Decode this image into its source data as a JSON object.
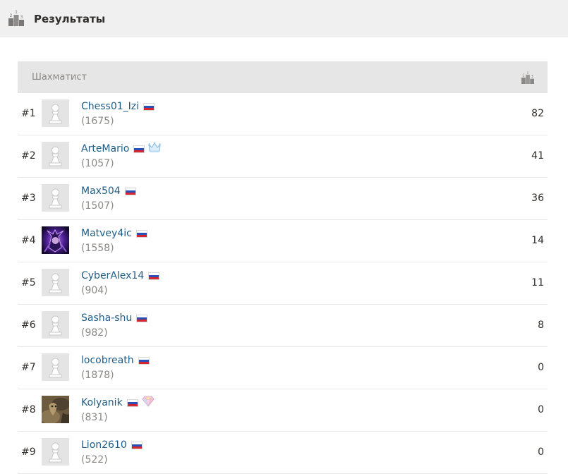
{
  "header": {
    "title": "Результаты",
    "icon": "podium-icon"
  },
  "table": {
    "column_player": "Шахматист",
    "column_score_icon": "podium-icon",
    "rows": [
      {
        "rank": "#1",
        "username": "Chess01_Izi",
        "rating": "(1675)",
        "score": "82",
        "avatar": "pawn",
        "flag": "ru",
        "badge": ""
      },
      {
        "rank": "#2",
        "username": "ArteMario",
        "rating": "(1057)",
        "score": "41",
        "avatar": "pawn",
        "flag": "ru",
        "badge": "crown-icon"
      },
      {
        "rank": "#3",
        "username": "Max504",
        "rating": "(1507)",
        "score": "36",
        "avatar": "pawn",
        "flag": "ru",
        "badge": ""
      },
      {
        "rank": "#4",
        "username": "Matvey4ic",
        "rating": "(1558)",
        "score": "14",
        "avatar": "custom-purple",
        "flag": "ru",
        "badge": ""
      },
      {
        "rank": "#5",
        "username": "CyberAlex14",
        "rating": "(904)",
        "score": "11",
        "avatar": "pawn",
        "flag": "ru",
        "badge": ""
      },
      {
        "rank": "#6",
        "username": "Sasha-shu",
        "rating": "(982)",
        "score": "8",
        "avatar": "pawn",
        "flag": "ru",
        "badge": ""
      },
      {
        "rank": "#7",
        "username": "locobreath",
        "rating": "(1878)",
        "score": "0",
        "avatar": "pawn",
        "flag": "ru",
        "badge": ""
      },
      {
        "rank": "#8",
        "username": "Kolyanik",
        "rating": "(831)",
        "score": "0",
        "avatar": "custom-photo",
        "flag": "ru",
        "badge": "diamond-icon"
      },
      {
        "rank": "#9",
        "username": "Lion2610",
        "rating": "(522)",
        "score": "0",
        "avatar": "pawn",
        "flag": "ru",
        "badge": ""
      }
    ]
  },
  "colors": {
    "username": "#205e87",
    "header_bg": "#f0f0f0",
    "table_header_bg": "#e6e6e6",
    "muted": "#8b8987",
    "flag_white": "#ffffff",
    "flag_blue": "#2a4fb7",
    "flag_red": "#d6262f"
  }
}
